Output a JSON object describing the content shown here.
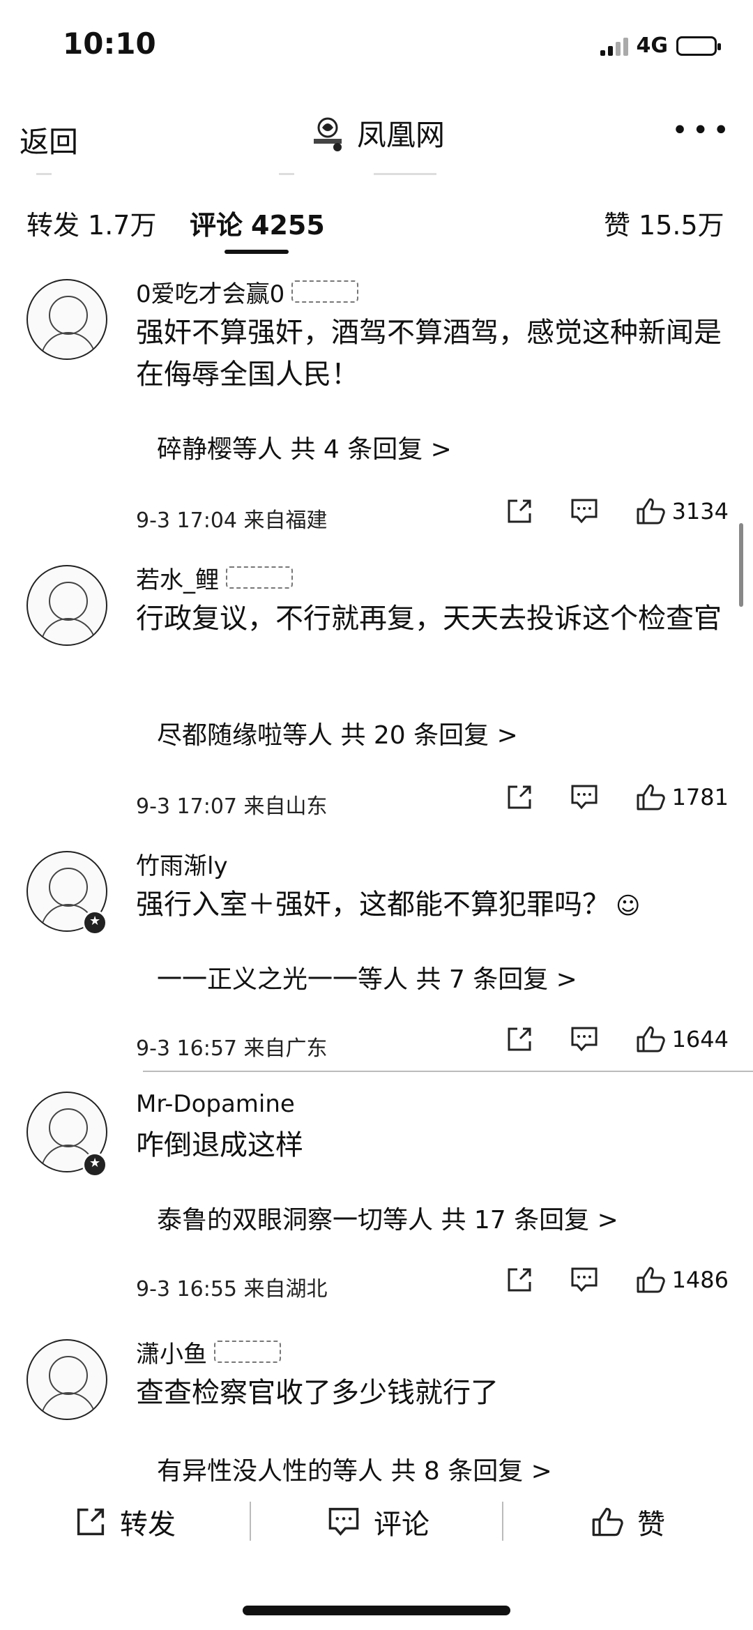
{
  "status": {
    "time": "10:10",
    "network": "4G"
  },
  "nav": {
    "back": "返回",
    "brand": "凤凰网",
    "more": "•••"
  },
  "tabs": {
    "repost": {
      "label": "转发",
      "count": "1.7万"
    },
    "comment": {
      "label": "评论",
      "count": "4255"
    },
    "like": {
      "label": "赞",
      "count": "15.5万"
    }
  },
  "comments": [
    {
      "user": "0爱吃才会赢0",
      "text": "强奸不算强奸，酒驾不算酒驾，感觉这种新闻是在侮辱全国人民！",
      "replies": "碎静樱等人  共 4 条回复 >",
      "time": "9-3 17:04  来自福建",
      "likes": "3134"
    },
    {
      "user": "若水_鲤",
      "text": "行政复议，不行就再复，天天去投诉这个检查官",
      "replies": "尽都随缘啦等人  共 20 条回复 >",
      "time": "9-3 17:07  来自山东",
      "likes": "1781"
    },
    {
      "user": "竹雨渐ly",
      "text": "强行入室＋强奸，这都能不算犯罪吗？",
      "replies": "一一正义之光一一等人  共 7 条回复 >",
      "time": "9-3 16:57  来自广东",
      "likes": "1644"
    },
    {
      "user": "Mr-Dopamine",
      "text": "咋倒退成这样",
      "replies": "泰鲁的双眼洞察一切等人  共 17 条回复 >",
      "time": "9-3 16:55  来自湖北",
      "likes": "1486"
    },
    {
      "user": "潇小鱼",
      "text": "查查检察官收了多少钱就行了",
      "replies": "有异性没人性的等人  共 8 条回复 >"
    }
  ],
  "bottom": {
    "repost": "转发",
    "comment": "评论",
    "like": "赞"
  }
}
